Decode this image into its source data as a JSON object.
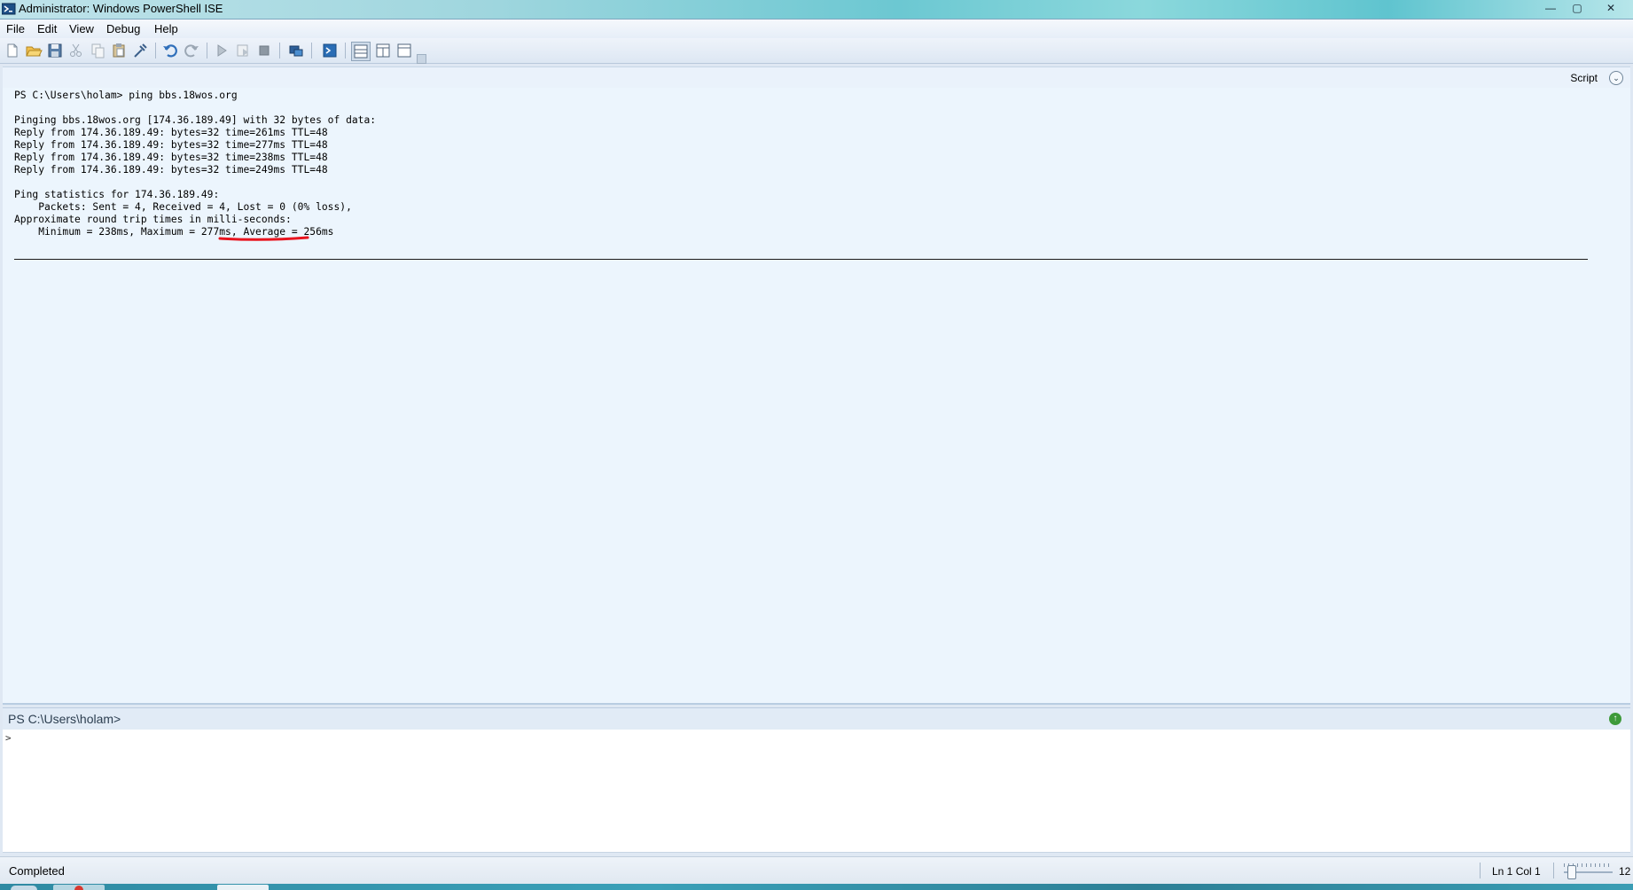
{
  "window": {
    "title": "Administrator: Windows PowerShell ISE",
    "controls": {
      "minimize": "—",
      "maximize": "▢",
      "close": "✕"
    }
  },
  "menu": [
    "File",
    "Edit",
    "View",
    "Debug",
    "Help"
  ],
  "toolbar": {
    "buttons": [
      "new-file-icon",
      "open-folder-icon",
      "save-icon",
      "cut-icon",
      "copy-icon",
      "paste-icon",
      "clear-icon",
      "undo-icon",
      "redo-icon",
      "run-icon",
      "run-selection-icon",
      "stop-icon",
      "remote-tab-icon",
      "start-powershell-icon",
      "layout-horizontal-icon",
      "layout-vertical-icon",
      "layout-maximize-icon"
    ]
  },
  "output_pane": {
    "script_label": "Script",
    "script_toggle": "⌄",
    "lines": [
      "PS C:\\Users\\holam> ping bbs.18wos.org",
      "",
      "Pinging bbs.18wos.org [174.36.189.49] with 32 bytes of data:",
      "Reply from 174.36.189.49: bytes=32 time=261ms TTL=48",
      "Reply from 174.36.189.49: bytes=32 time=277ms TTL=48",
      "Reply from 174.36.189.49: bytes=32 time=238ms TTL=48",
      "Reply from 174.36.189.49: bytes=32 time=249ms TTL=48",
      "",
      "Ping statistics for 174.36.189.49:",
      "    Packets: Sent = 4, Received = 4, Lost = 0 (0% loss),",
      "Approximate round trip times in milli-seconds:",
      "    Minimum = 238ms, Maximum = 277ms, Average = 256ms"
    ],
    "highlight_color": "#e8141e"
  },
  "command_pane": {
    "prompt": "PS C:\\Users\\holam>",
    "caret": ">",
    "up_icon": "↑"
  },
  "status_bar": {
    "status": "Completed",
    "position": "Ln 1  Col 1",
    "zoom": "12"
  }
}
